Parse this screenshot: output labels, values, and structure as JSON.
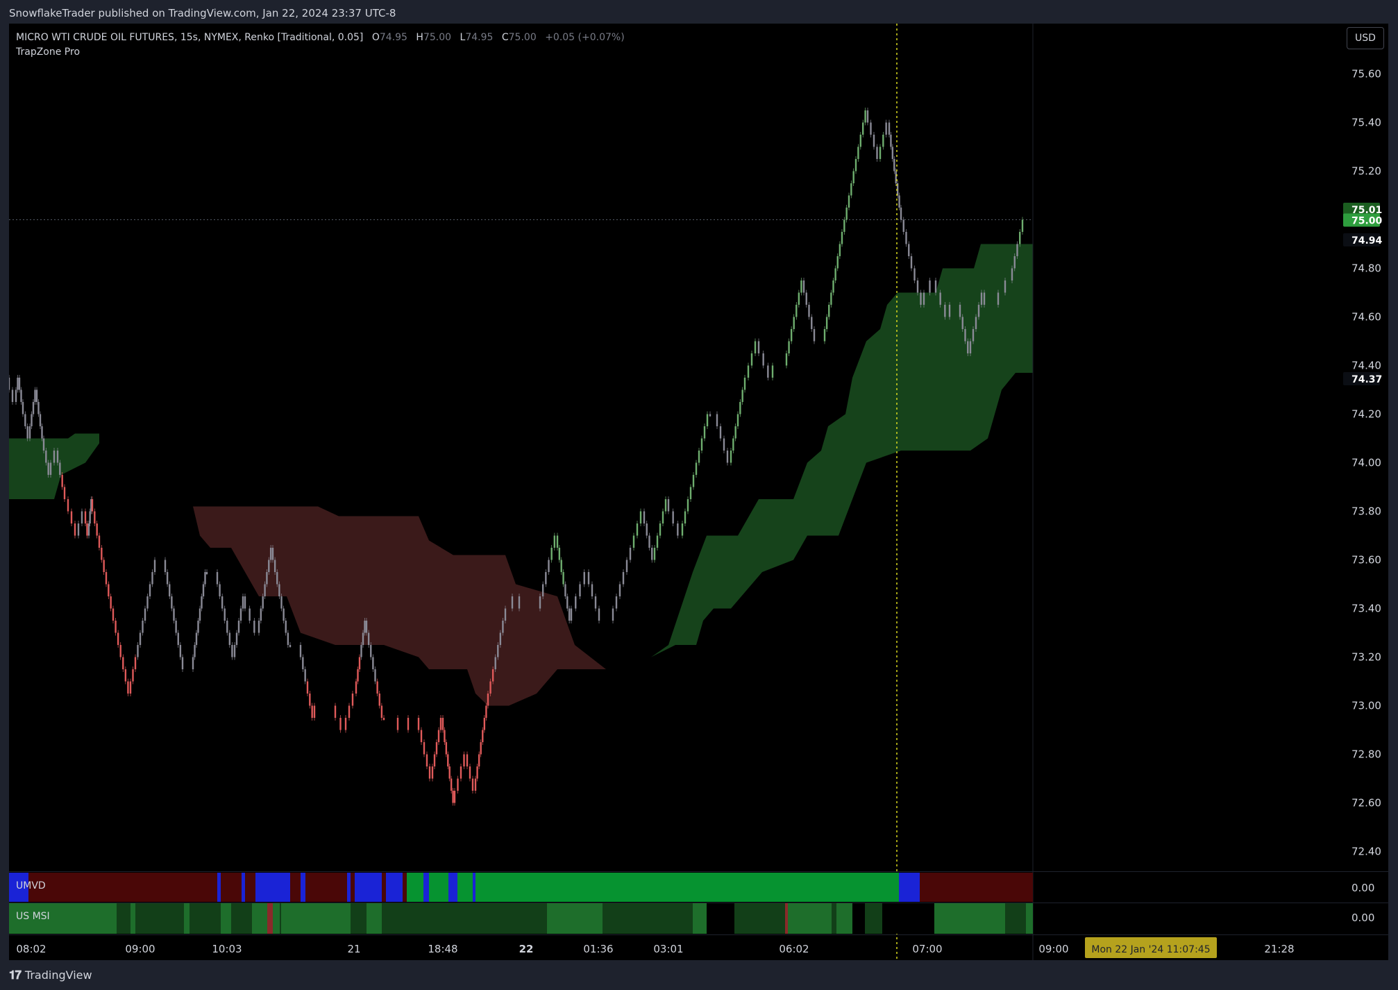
{
  "header": {
    "published": "SnowflakeTrader published on TradingView.com, Jan 22, 2024 23:37 UTC-8"
  },
  "legend": {
    "symbol": "MICRO WTI CRUDE OIL FUTURES, 15s, NYMEX, Renko [Traditional, 0.05]",
    "o_label": "O",
    "o_value": "74.95",
    "h_label": "H",
    "h_value": "75.00",
    "l_label": "L",
    "l_value": "74.95",
    "c_label": "C",
    "c_value": "75.00",
    "change": "+0.05 (+0.07%)",
    "indicator": "TrapZone Pro"
  },
  "currency_button": "USD",
  "panes": {
    "umvd_label": "UMVD",
    "umvd_value": "0.00",
    "usmsi_label": "US MSI",
    "usmsi_value": "0.00"
  },
  "footer": {
    "brand": "TradingView",
    "logo_icon": "tradingview-logo-icon"
  },
  "colors": {
    "background": "#000000",
    "frame": "#1e222d",
    "brick_up": "#6fae6f",
    "brick_down": "#e05a5a",
    "brick_neutral": "#8a8a96",
    "zone_green": "#16431b",
    "zone_red": "#3b1a1a",
    "umvd_red": "#4a0707",
    "umvd_blue": "#1a23d6",
    "umvd_green": "#069330",
    "msi_light": "#1e6e2b",
    "msi_dark": "#123f18",
    "crosshair": "#d8d81e",
    "current_price": "#2e8b3a"
  },
  "chart_data": {
    "type": "line",
    "title": "MICRO WTI CRUDE OIL FUTURES, 15s, NYMEX, Renko [Traditional, 0.05]",
    "ylim": [
      72.3,
      75.75
    ],
    "y_ticks": [
      "75.60",
      "75.40",
      "75.20",
      "74.80",
      "74.60",
      "74.40",
      "74.20",
      "74.00",
      "73.80",
      "73.60",
      "73.40",
      "73.20",
      "73.00",
      "72.80",
      "72.60",
      "72.40"
    ],
    "x_ticks": [
      {
        "label": "08:02",
        "bold": false
      },
      {
        "label": "09:00",
        "bold": false
      },
      {
        "label": "10:03",
        "bold": false
      },
      {
        "label": "21",
        "bold": false
      },
      {
        "label": "18:48",
        "bold": false
      },
      {
        "label": "22",
        "bold": true
      },
      {
        "label": "01:36",
        "bold": false
      },
      {
        "label": "03:01",
        "bold": false
      },
      {
        "label": "06:02",
        "bold": false
      },
      {
        "label": "07:00",
        "bold": false
      },
      {
        "label": "09:00",
        "bold": false
      },
      {
        "label": "21:28",
        "bold": false
      }
    ],
    "crosshair_label": "Mon 22 Jan '24   11:07:45",
    "price_labels": [
      {
        "value": 75.01,
        "text": "75.01",
        "color": "#1b5e20"
      },
      {
        "value": 75.0,
        "text": "75.00",
        "color": "#2e9e3e"
      },
      {
        "value": 74.94,
        "text": "74.94",
        "color": "#0b0e14"
      },
      {
        "value": 74.37,
        "text": "74.37",
        "color": "#0b0e14"
      }
    ],
    "close_path": [
      {
        "x": 0,
        "y": 74.35
      },
      {
        "x": 10,
        "y": 74.25
      },
      {
        "x": 15,
        "y": 74.35
      },
      {
        "x": 20,
        "y": 74.25
      },
      {
        "x": 30,
        "y": 74.1
      },
      {
        "x": 40,
        "y": 74.3
      },
      {
        "x": 50,
        "y": 74.1
      },
      {
        "x": 60,
        "y": 73.95
      },
      {
        "x": 70,
        "y": 74.05
      },
      {
        "x": 80,
        "y": 73.9
      },
      {
        "x": 100,
        "y": 73.7
      },
      {
        "x": 110,
        "y": 73.8
      },
      {
        "x": 115,
        "y": 73.7
      },
      {
        "x": 120,
        "y": 73.85
      },
      {
        "x": 150,
        "y": 73.4
      },
      {
        "x": 175,
        "y": 73.05
      },
      {
        "x": 210,
        "y": 73.55
      },
      {
        "x": 225,
        "y": 73.6
      },
      {
        "x": 250,
        "y": 73.2
      },
      {
        "x": 265,
        "y": 73.15
      },
      {
        "x": 285,
        "y": 73.55
      },
      {
        "x": 300,
        "y": 73.55
      },
      {
        "x": 325,
        "y": 73.2
      },
      {
        "x": 340,
        "y": 73.45
      },
      {
        "x": 360,
        "y": 73.3
      },
      {
        "x": 380,
        "y": 73.65
      },
      {
        "x": 405,
        "y": 73.25
      },
      {
        "x": 420,
        "y": 73.25
      },
      {
        "x": 440,
        "y": 72.95
      },
      {
        "x": 470,
        "y": 73.0
      },
      {
        "x": 485,
        "y": 72.9
      },
      {
        "x": 500,
        "y": 73.05
      },
      {
        "x": 515,
        "y": 73.35
      },
      {
        "x": 540,
        "y": 72.95
      },
      {
        "x": 560,
        "y": 72.95
      },
      {
        "x": 575,
        "y": 72.9
      },
      {
        "x": 590,
        "y": 72.95
      },
      {
        "x": 610,
        "y": 72.7
      },
      {
        "x": 625,
        "y": 72.95
      },
      {
        "x": 642,
        "y": 72.6
      },
      {
        "x": 660,
        "y": 72.8
      },
      {
        "x": 672,
        "y": 72.65
      },
      {
        "x": 690,
        "y": 73.0
      },
      {
        "x": 715,
        "y": 73.35
      },
      {
        "x": 735,
        "y": 73.45
      },
      {
        "x": 765,
        "y": 73.4
      },
      {
        "x": 790,
        "y": 73.7
      },
      {
        "x": 810,
        "y": 73.35
      },
      {
        "x": 835,
        "y": 73.55
      },
      {
        "x": 850,
        "y": 73.4
      },
      {
        "x": 870,
        "y": 73.35
      },
      {
        "x": 895,
        "y": 73.6
      },
      {
        "x": 915,
        "y": 73.8
      },
      {
        "x": 930,
        "y": 73.6
      },
      {
        "x": 950,
        "y": 73.85
      },
      {
        "x": 970,
        "y": 73.7
      },
      {
        "x": 990,
        "y": 73.95
      },
      {
        "x": 1010,
        "y": 74.2
      },
      {
        "x": 1020,
        "y": 74.2
      },
      {
        "x": 1040,
        "y": 74.0
      },
      {
        "x": 1060,
        "y": 74.3
      },
      {
        "x": 1080,
        "y": 74.5
      },
      {
        "x": 1100,
        "y": 74.35
      },
      {
        "x": 1120,
        "y": 74.4
      },
      {
        "x": 1145,
        "y": 74.75
      },
      {
        "x": 1160,
        "y": 74.55
      },
      {
        "x": 1175,
        "y": 74.5
      },
      {
        "x": 1200,
        "y": 74.9
      },
      {
        "x": 1220,
        "y": 75.2
      },
      {
        "x": 1237,
        "y": 75.45
      },
      {
        "x": 1255,
        "y": 75.25
      },
      {
        "x": 1268,
        "y": 75.4
      },
      {
        "x": 1285,
        "y": 75.05
      },
      {
        "x": 1300,
        "y": 74.85
      },
      {
        "x": 1318,
        "y": 74.65
      },
      {
        "x": 1335,
        "y": 74.75
      },
      {
        "x": 1355,
        "y": 74.6
      },
      {
        "x": 1370,
        "y": 74.65
      },
      {
        "x": 1385,
        "y": 74.45
      },
      {
        "x": 1405,
        "y": 74.7
      },
      {
        "x": 1425,
        "y": 74.65
      },
      {
        "x": 1445,
        "y": 74.75
      },
      {
        "x": 1460,
        "y": 74.95
      },
      {
        "x": 1470,
        "y": 75.0
      }
    ],
    "zones": [
      {
        "type": "green",
        "top": [
          {
            "x": 0,
            "y": 74.1
          },
          {
            "x": 85,
            "y": 74.1
          },
          {
            "x": 95,
            "y": 74.12
          },
          {
            "x": 130,
            "y": 74.12
          }
        ],
        "bottom": [
          {
            "x": 0,
            "y": 73.85
          },
          {
            "x": 65,
            "y": 73.85
          },
          {
            "x": 75,
            "y": 73.95
          },
          {
            "x": 110,
            "y": 74.0
          },
          {
            "x": 130,
            "y": 74.08
          }
        ]
      },
      {
        "type": "red",
        "top": [
          {
            "x": 265,
            "y": 73.82
          },
          {
            "x": 445,
            "y": 73.82
          },
          {
            "x": 475,
            "y": 73.78
          },
          {
            "x": 590,
            "y": 73.78
          },
          {
            "x": 605,
            "y": 73.68
          },
          {
            "x": 640,
            "y": 73.62
          },
          {
            "x": 715,
            "y": 73.62
          },
          {
            "x": 730,
            "y": 73.5
          },
          {
            "x": 790,
            "y": 73.45
          },
          {
            "x": 815,
            "y": 73.25
          },
          {
            "x": 860,
            "y": 73.15
          }
        ],
        "bottom": [
          {
            "x": 265,
            "y": 73.82
          },
          {
            "x": 275,
            "y": 73.7
          },
          {
            "x": 290,
            "y": 73.65
          },
          {
            "x": 320,
            "y": 73.65
          },
          {
            "x": 340,
            "y": 73.55
          },
          {
            "x": 360,
            "y": 73.45
          },
          {
            "x": 400,
            "y": 73.45
          },
          {
            "x": 420,
            "y": 73.3
          },
          {
            "x": 470,
            "y": 73.25
          },
          {
            "x": 540,
            "y": 73.25
          },
          {
            "x": 590,
            "y": 73.2
          },
          {
            "x": 605,
            "y": 73.15
          },
          {
            "x": 660,
            "y": 73.15
          },
          {
            "x": 672,
            "y": 73.05
          },
          {
            "x": 690,
            "y": 73.0
          },
          {
            "x": 720,
            "y": 73.0
          },
          {
            "x": 760,
            "y": 73.05
          },
          {
            "x": 790,
            "y": 73.15
          },
          {
            "x": 860,
            "y": 73.15
          }
        ]
      },
      {
        "type": "green",
        "top": [
          {
            "x": 925,
            "y": 73.2
          },
          {
            "x": 950,
            "y": 73.25
          },
          {
            "x": 985,
            "y": 73.55
          },
          {
            "x": 1005,
            "y": 73.7
          },
          {
            "x": 1050,
            "y": 73.7
          },
          {
            "x": 1080,
            "y": 73.85
          },
          {
            "x": 1130,
            "y": 73.85
          },
          {
            "x": 1150,
            "y": 74.0
          },
          {
            "x": 1170,
            "y": 74.05
          },
          {
            "x": 1180,
            "y": 74.15
          },
          {
            "x": 1205,
            "y": 74.2
          },
          {
            "x": 1215,
            "y": 74.35
          },
          {
            "x": 1235,
            "y": 74.5
          },
          {
            "x": 1255,
            "y": 74.55
          },
          {
            "x": 1265,
            "y": 74.65
          },
          {
            "x": 1280,
            "y": 74.7
          },
          {
            "x": 1335,
            "y": 74.7
          },
          {
            "x": 1345,
            "y": 74.8
          },
          {
            "x": 1390,
            "y": 74.8
          },
          {
            "x": 1400,
            "y": 74.9
          },
          {
            "x": 1475,
            "y": 74.9
          }
        ],
        "bottom": [
          {
            "x": 925,
            "y": 73.2
          },
          {
            "x": 960,
            "y": 73.25
          },
          {
            "x": 990,
            "y": 73.25
          },
          {
            "x": 1000,
            "y": 73.35
          },
          {
            "x": 1015,
            "y": 73.4
          },
          {
            "x": 1040,
            "y": 73.4
          },
          {
            "x": 1070,
            "y": 73.5
          },
          {
            "x": 1085,
            "y": 73.55
          },
          {
            "x": 1130,
            "y": 73.6
          },
          {
            "x": 1150,
            "y": 73.7
          },
          {
            "x": 1195,
            "y": 73.7
          },
          {
            "x": 1215,
            "y": 73.85
          },
          {
            "x": 1235,
            "y": 74.0
          },
          {
            "x": 1285,
            "y": 74.05
          },
          {
            "x": 1385,
            "y": 74.05
          },
          {
            "x": 1410,
            "y": 74.1
          },
          {
            "x": 1430,
            "y": 74.3
          },
          {
            "x": 1450,
            "y": 74.37
          },
          {
            "x": 1475,
            "y": 74.37
          }
        ]
      }
    ],
    "umvd_segments": [
      {
        "from": 0,
        "to": 28,
        "color": "blue"
      },
      {
        "from": 28,
        "to": 300,
        "color": "red"
      },
      {
        "from": 300,
        "to": 305,
        "color": "blue"
      },
      {
        "from": 305,
        "to": 335,
        "color": "red"
      },
      {
        "from": 335,
        "to": 340,
        "color": "blue"
      },
      {
        "from": 340,
        "to": 355,
        "color": "red"
      },
      {
        "from": 355,
        "to": 405,
        "color": "blue"
      },
      {
        "from": 405,
        "to": 420,
        "color": "red"
      },
      {
        "from": 420,
        "to": 427,
        "color": "blue"
      },
      {
        "from": 427,
        "to": 487,
        "color": "red"
      },
      {
        "from": 487,
        "to": 492,
        "color": "blue"
      },
      {
        "from": 492,
        "to": 498,
        "color": "red"
      },
      {
        "from": 498,
        "to": 537,
        "color": "blue"
      },
      {
        "from": 537,
        "to": 543,
        "color": "red"
      },
      {
        "from": 543,
        "to": 567,
        "color": "blue"
      },
      {
        "from": 567,
        "to": 573,
        "color": "red"
      },
      {
        "from": 573,
        "to": 597,
        "color": "green"
      },
      {
        "from": 597,
        "to": 605,
        "color": "blue"
      },
      {
        "from": 605,
        "to": 633,
        "color": "green"
      },
      {
        "from": 633,
        "to": 646,
        "color": "blue"
      },
      {
        "from": 646,
        "to": 668,
        "color": "green"
      },
      {
        "from": 668,
        "to": 672,
        "color": "blue"
      },
      {
        "from": 672,
        "to": 1282,
        "color": "green"
      },
      {
        "from": 1282,
        "to": 1312,
        "color": "blue"
      },
      {
        "from": 1312,
        "to": 1475,
        "color": "red"
      }
    ],
    "msi_segments": [
      {
        "from": 0,
        "to": 155,
        "color": "light"
      },
      {
        "from": 155,
        "to": 175,
        "color": "dark"
      },
      {
        "from": 175,
        "to": 182,
        "color": "light"
      },
      {
        "from": 182,
        "to": 252,
        "color": "dark"
      },
      {
        "from": 252,
        "to": 260,
        "color": "light"
      },
      {
        "from": 260,
        "to": 305,
        "color": "dark"
      },
      {
        "from": 305,
        "to": 320,
        "color": "light"
      },
      {
        "from": 320,
        "to": 350,
        "color": "dark"
      },
      {
        "from": 350,
        "to": 372,
        "color": "light"
      },
      {
        "from": 372,
        "to": 380,
        "color": "red"
      },
      {
        "from": 380,
        "to": 390,
        "color": "light"
      },
      {
        "from": 390,
        "to": 492,
        "color": "dark"
      },
      {
        "from": 392,
        "to": 492,
        "color": "light"
      },
      {
        "from": 492,
        "to": 515,
        "color": "dark"
      },
      {
        "from": 515,
        "to": 537,
        "color": "light"
      },
      {
        "from": 537,
        "to": 775,
        "color": "dark"
      },
      {
        "from": 775,
        "to": 855,
        "color": "light"
      },
      {
        "from": 855,
        "to": 985,
        "color": "dark"
      },
      {
        "from": 985,
        "to": 1005,
        "color": "light"
      },
      {
        "from": 1005,
        "to": 1045,
        "color": "black"
      },
      {
        "from": 1045,
        "to": 1118,
        "color": "dark"
      },
      {
        "from": 1118,
        "to": 1122,
        "color": "red"
      },
      {
        "from": 1122,
        "to": 1185,
        "color": "light"
      },
      {
        "from": 1185,
        "to": 1192,
        "color": "dark"
      },
      {
        "from": 1192,
        "to": 1215,
        "color": "light"
      },
      {
        "from": 1215,
        "to": 1233,
        "color": "black"
      },
      {
        "from": 1233,
        "to": 1258,
        "color": "dark"
      },
      {
        "from": 1258,
        "to": 1333,
        "color": "black"
      },
      {
        "from": 1333,
        "to": 1435,
        "color": "light"
      },
      {
        "from": 1435,
        "to": 1465,
        "color": "dark"
      },
      {
        "from": 1465,
        "to": 1475,
        "color": "light"
      }
    ]
  }
}
